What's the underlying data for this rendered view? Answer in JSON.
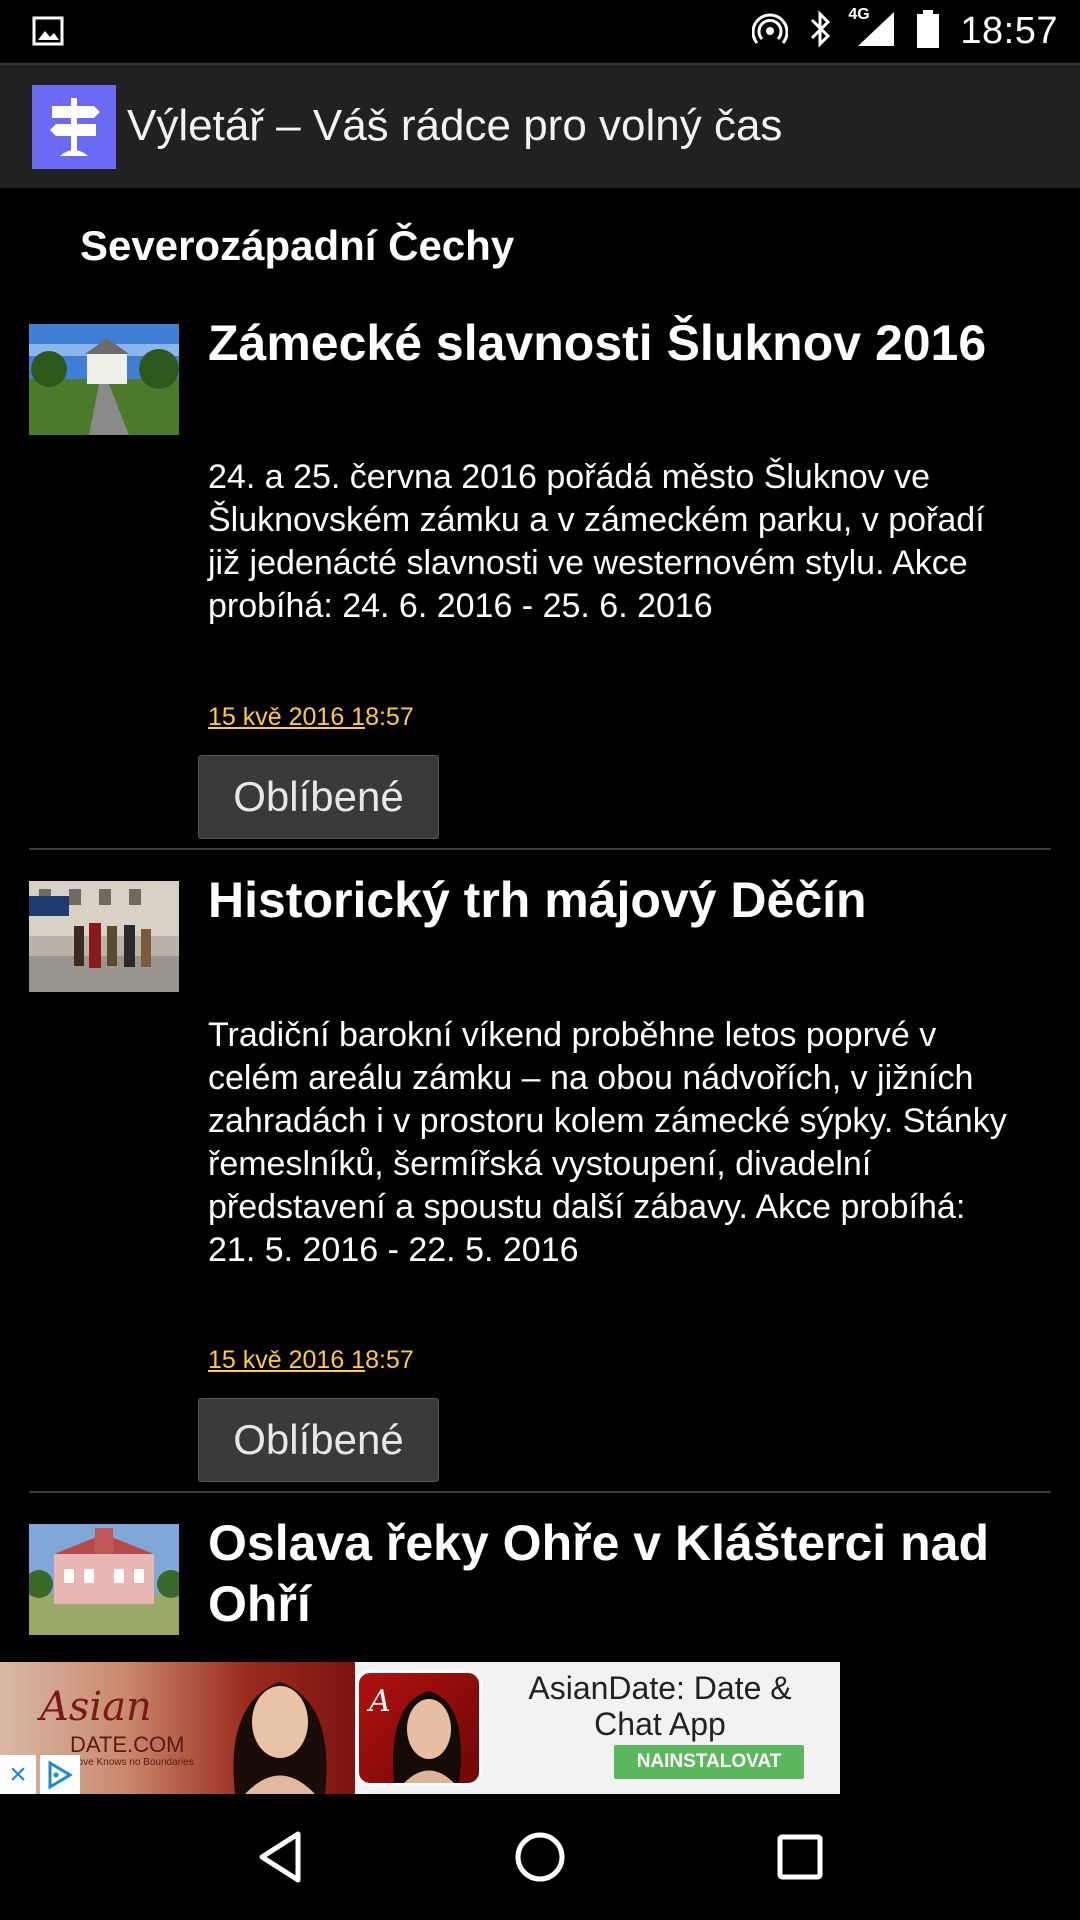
{
  "status_bar": {
    "time": "18:57",
    "network": "4G",
    "icons": [
      "image-icon",
      "hotspot-icon",
      "bluetooth-icon",
      "signal-icon",
      "battery-icon"
    ]
  },
  "app_bar": {
    "title": "Výletář – Váš rádce pro volný čas",
    "logo": "signpost-logo"
  },
  "section": {
    "title": "Severozápadní Čechy"
  },
  "items": [
    {
      "title": "Zámecké slavnosti Šluknov 2016",
      "description": "24. a 25. června 2016 pořádá město Šluknov ve Šluknovském zámku a v zámeckém parku, v pořadí již jedenácté slavnosti ve westernovém stylu.  Akce probíhá: 24. 6. 2016 - 25. 6. 2016",
      "date_link": "15 kvě 2016 1",
      "date_rest": "8:57",
      "button": "Oblíbené"
    },
    {
      "title": "Historický trh májový Děčín",
      "description": "Tradiční barokní víkend proběhne letos poprvé v celém areálu zámku – na obou nádvořích, v jižních zahradách i v prostoru kolem zámecké sýpky. Stánky řemeslníků, šermířská vystoupení, divadelní představení a spoustu další zábavy. Akce probíhá: 21. 5. 2016 - 22. 5. 2016",
      "date_link": "15 kvě 2016 1",
      "date_rest": "8:57",
      "button": "Oblíbené"
    },
    {
      "title": "Oslava řeky Ohře v Klášterci nad Ohří"
    }
  ],
  "ad": {
    "brand": "Asian",
    "brand_sub": "DATE.COM",
    "brand_tag": "Love Knows no Boundaries",
    "title": "AsianDate: Date & Chat App",
    "install": "NAINSTALOVAT"
  },
  "colors": {
    "background": "#000000",
    "app_bar": "#212121",
    "logo_bg": "#6a6af4",
    "date_link": "#ffcc33",
    "button_bg": "#3a3a3a",
    "install_bg": "#5cb85c"
  }
}
